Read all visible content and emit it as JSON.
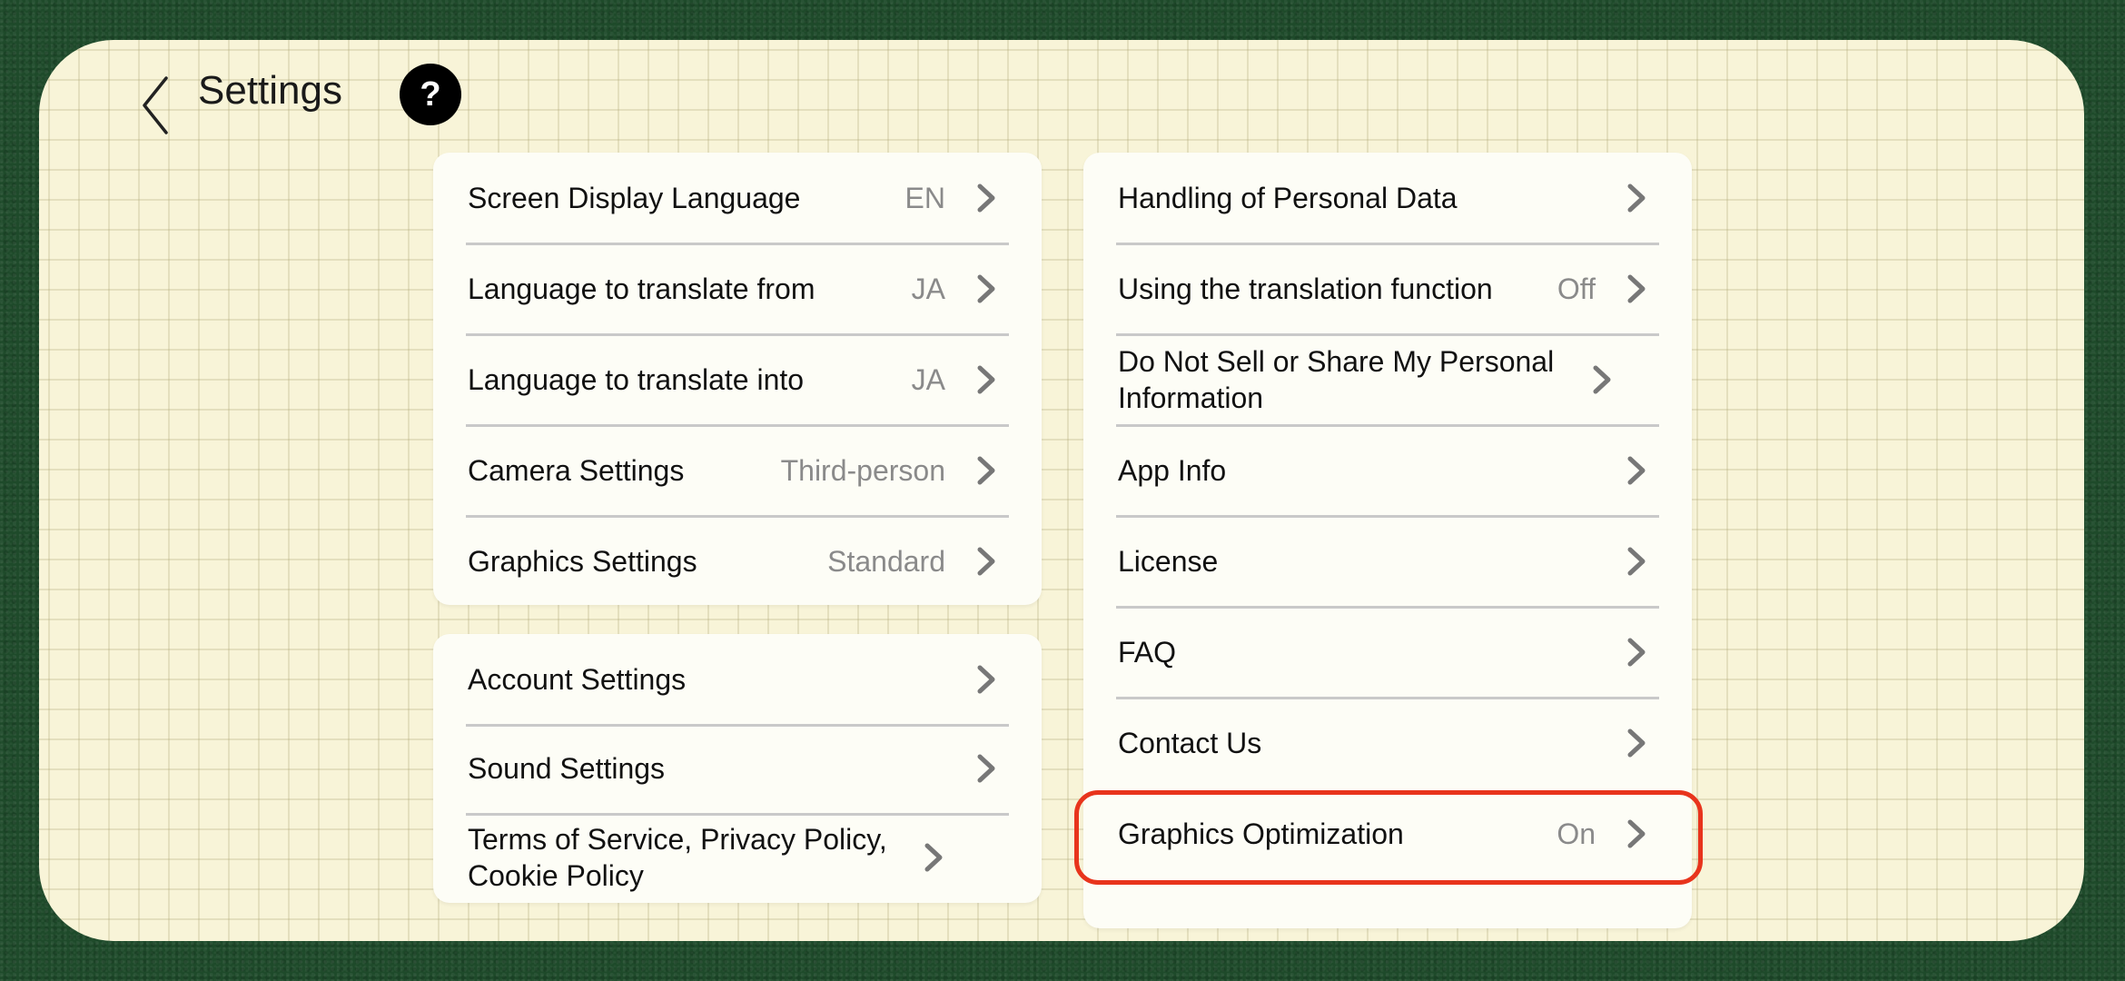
{
  "header": {
    "title": "Settings",
    "help_label": "?"
  },
  "left_card_1": {
    "items": [
      {
        "label": "Screen Display Language",
        "value": "EN"
      },
      {
        "label": "Language to translate from",
        "value": "JA"
      },
      {
        "label": "Language to translate into",
        "value": "JA"
      },
      {
        "label": "Camera Settings",
        "value": "Third-person"
      },
      {
        "label": "Graphics Settings",
        "value": "Standard"
      }
    ]
  },
  "left_card_2": {
    "items": [
      {
        "label": "Account Settings"
      },
      {
        "label": "Sound Settings"
      },
      {
        "label": "Terms of Service, Privacy Policy, Cookie Policy"
      }
    ]
  },
  "right_card": {
    "items": [
      {
        "label": "Handling of Personal Data"
      },
      {
        "label": "Using the translation function",
        "value": "Off"
      },
      {
        "label": "Do Not Sell or Share My Personal Information"
      },
      {
        "label": "App Info"
      },
      {
        "label": "License"
      },
      {
        "label": "FAQ"
      },
      {
        "label": "Contact Us"
      },
      {
        "label": "Graphics Optimization",
        "value": "On"
      }
    ]
  },
  "colors": {
    "highlight": "#e8341c",
    "panel": "#f8f4d8",
    "background": "#1e4a2a"
  },
  "icons": {
    "back": "chevron-left-icon",
    "row": "chevron-right-icon",
    "help": "question-icon"
  }
}
